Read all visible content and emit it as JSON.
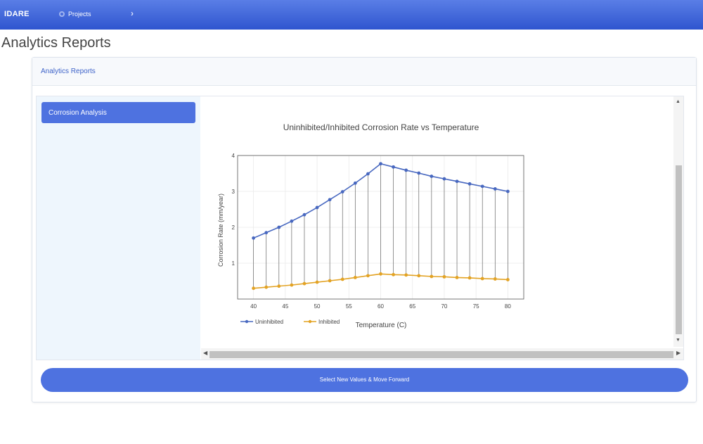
{
  "topbar": {
    "brand": "IDARE",
    "projects_label": "Projects",
    "chevron": "›",
    "icons": {
      "projects": "gear-icon",
      "chevron": "chevron-right-icon"
    }
  },
  "page": {
    "title": "Analytics Reports"
  },
  "card": {
    "header": "Analytics Reports"
  },
  "sidebar": {
    "items": [
      {
        "label": "Corrosion Analysis",
        "active": true
      }
    ]
  },
  "chart_data": {
    "type": "line",
    "title": "Uninhibited/Inhibited Corrosion Rate vs Temperature",
    "xlabel": "Temperature (C)",
    "ylabel": "Corrosion Rate (mm/year)",
    "xlim": [
      37.5,
      82.5
    ],
    "ylim": [
      0,
      4
    ],
    "xticks": [
      40,
      45,
      50,
      55,
      60,
      65,
      70,
      75,
      80
    ],
    "yticks": [
      1,
      2,
      3,
      4
    ],
    "grid": true,
    "legend_position": "bottom-left",
    "drop_lines": true,
    "x": [
      40,
      42,
      44,
      46,
      48,
      50,
      52,
      54,
      56,
      58,
      60,
      62,
      64,
      66,
      68,
      70,
      72,
      74,
      76,
      78,
      80
    ],
    "series": [
      {
        "name": "Uninhibited",
        "color": "#4868c0",
        "values": [
          1.7,
          1.85,
          2.0,
          2.17,
          2.35,
          2.55,
          2.77,
          2.99,
          3.23,
          3.49,
          3.77,
          3.68,
          3.59,
          3.51,
          3.42,
          3.35,
          3.28,
          3.21,
          3.14,
          3.07,
          3.0
        ]
      },
      {
        "name": "Inhibited",
        "color": "#e3a324",
        "values": [
          0.3,
          0.33,
          0.36,
          0.39,
          0.43,
          0.47,
          0.51,
          0.55,
          0.6,
          0.65,
          0.7,
          0.68,
          0.67,
          0.65,
          0.63,
          0.62,
          0.6,
          0.59,
          0.57,
          0.56,
          0.54
        ]
      }
    ]
  },
  "cta": {
    "label": "Select New Values & Move Forward"
  },
  "scrollbars": {
    "up": "▲",
    "down": "▼",
    "left": "◀",
    "right": "▶"
  }
}
